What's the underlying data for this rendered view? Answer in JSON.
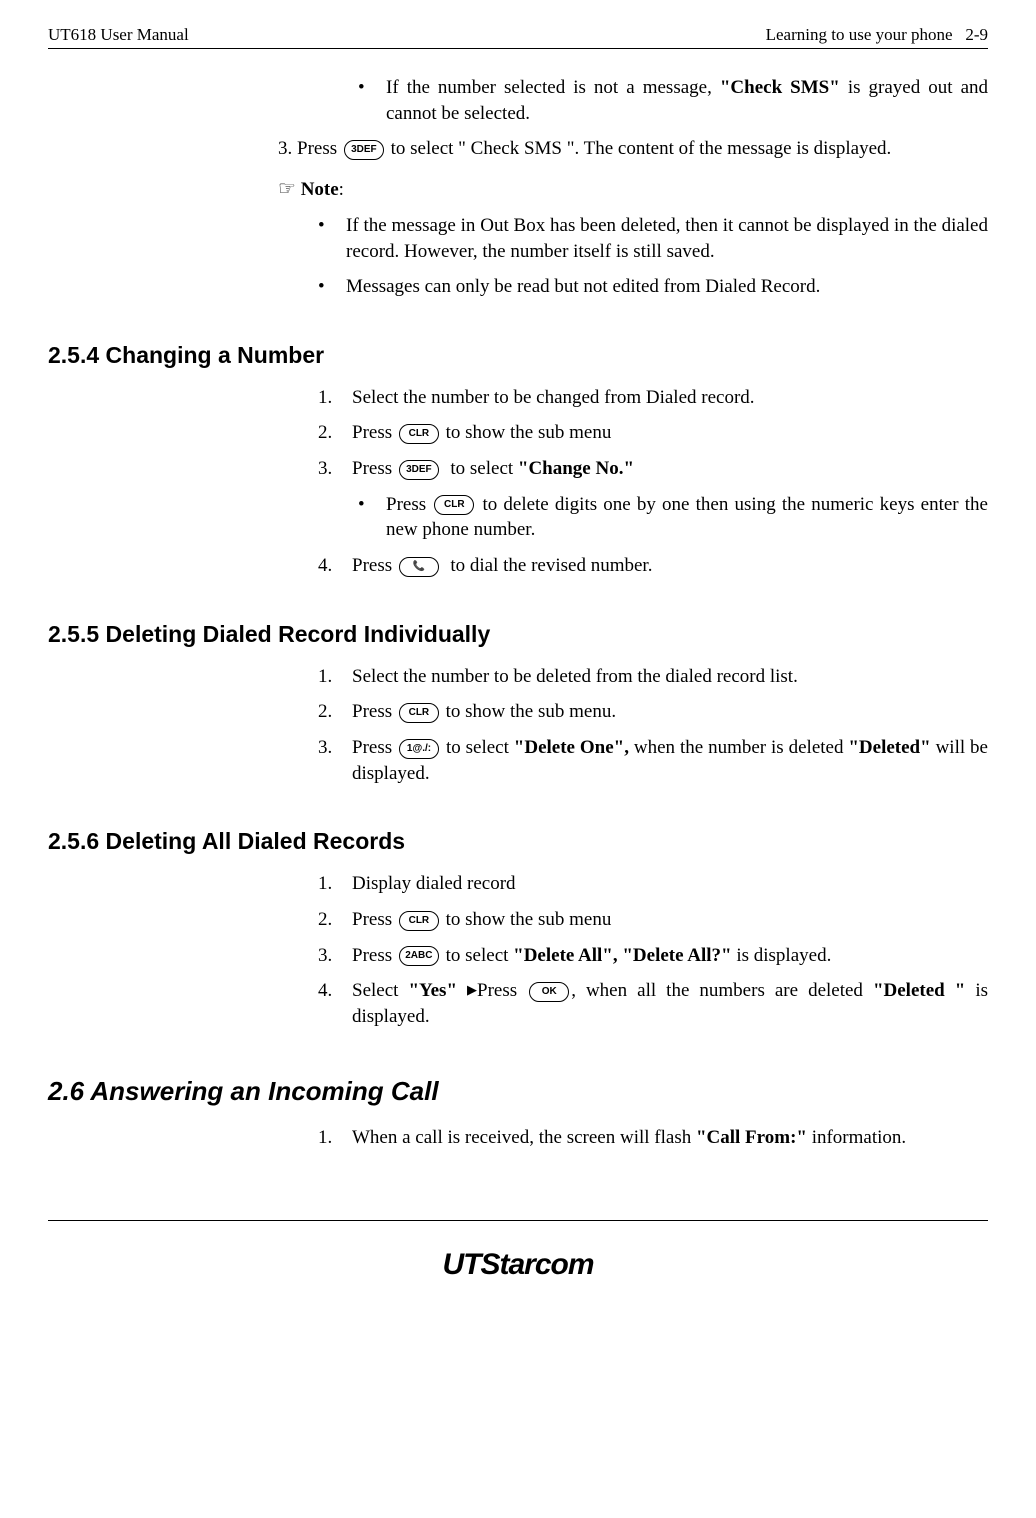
{
  "header": {
    "left": "UT618 User Manual",
    "right_title": "Learning to use your phone",
    "right_page": "2-9"
  },
  "top_block": {
    "bullet1_a": "If the number selected is not a message, ",
    "bullet1_b": "\"Check SMS\"",
    "bullet1_c": " is grayed out and cannot be selected.",
    "line3_a": "3. Press ",
    "line3_key": "3DEF",
    "line3_b": " to select \" Check SMS \". The content of the message is displayed.",
    "note_label": "Note",
    "note_colon": ":",
    "note_b1": "If the message in Out Box has been deleted, then it cannot be displayed in the dialed record. However, the number itself is still saved.",
    "note_b2": "Messages can only be read but not edited from Dialed Record."
  },
  "sec254": {
    "title": "2.5.4 Changing a Number",
    "s1": "Select the number to be changed from Dialed record.",
    "s2a": "Press ",
    "s2key": "CLR",
    "s2b": " to show the sub menu",
    "s3a": "Press ",
    "s3key": "3DEF",
    "s3b": " to select ",
    "s3bold": "\"Change No.\"",
    "sub_a": "Press ",
    "sub_key": "CLR",
    "sub_b": " to delete digits one by one then using the numeric keys enter the new phone number.",
    "s4a": "Press ",
    "s4key": "📞",
    "s4b": " to dial the revised number."
  },
  "sec255": {
    "title": "2.5.5 Deleting Dialed Record Individually",
    "s1": "Select the number to be deleted from the dialed record list.",
    "s2a": "Press ",
    "s2key": "CLR",
    "s2b": " to show the sub menu.",
    "s3a": "Press ",
    "s3key": "1@./:",
    "s3b": " to select ",
    "s3bold": "\"Delete One\",",
    "s3c": " when the number is deleted ",
    "s3bold2": "\"Deleted\"",
    "s3d": " will be displayed."
  },
  "sec256": {
    "title": "2.5.6 Deleting All Dialed Records",
    "s1": "Display dialed record",
    "s2a": "Press ",
    "s2key": "CLR",
    "s2b": " to show the sub menu",
    "s3a": "Press ",
    "s3key": "2ABC",
    "s3b": " to select ",
    "s3bold": "\"Delete All\", \"Delete All?\"",
    "s3c": " is displayed.",
    "s4a": "Select ",
    "s4bold": "\"Yes\"",
    "s4tri": "▶",
    "s4b": "Press ",
    "s4key": "OK",
    "s4c": ", when all the numbers are deleted ",
    "s4bold2": "\"Deleted \"",
    "s4d": " is displayed."
  },
  "sec26": {
    "title": "2.6   Answering an Incoming Call",
    "s1a": "When a call is received, the screen will flash ",
    "s1bold": "\"Call From:\"",
    "s1b": " information."
  },
  "brand": {
    "ut": "UT",
    "rest": "Starcom"
  }
}
